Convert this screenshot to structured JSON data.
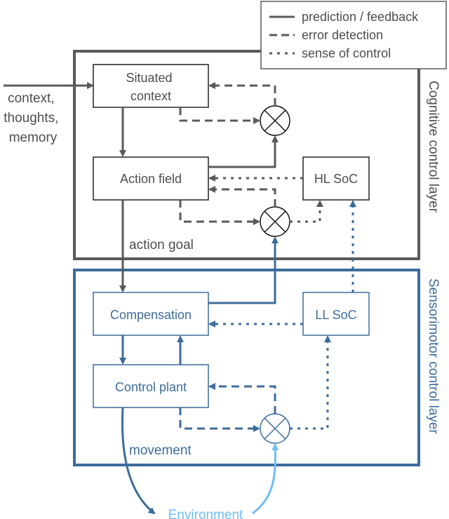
{
  "legend": {
    "items": [
      {
        "style": "solid",
        "label": "prediction / feedback"
      },
      {
        "style": "dashed",
        "label": "error detection"
      },
      {
        "style": "dotted",
        "label": "sense of control"
      }
    ]
  },
  "layers": {
    "cognitive": {
      "label": "Cognitive control layer",
      "color": "#5a5a5a"
    },
    "sensorimotor": {
      "label": "Sensorimotor control layer",
      "color": "#3d6c9b"
    }
  },
  "input": {
    "lines": [
      "context,",
      "thoughts,",
      "memory"
    ]
  },
  "nodes": {
    "situated_context": {
      "lines": [
        "Situated",
        "context"
      ]
    },
    "action_field": {
      "label": "Action field"
    },
    "hl_soc": {
      "label": "HL SoC"
    },
    "compensation": {
      "label": "Compensation"
    },
    "ll_soc": {
      "label": "LL SoC"
    },
    "control_plant": {
      "label": "Control plant"
    },
    "environment": {
      "label": "Environment"
    }
  },
  "edge_labels": {
    "action_goal": "action goal",
    "movement": "movement"
  },
  "colors": {
    "gray": "#5a5a5a",
    "blue": "#3d6c9b",
    "light_blue": "#6fbdf5"
  }
}
